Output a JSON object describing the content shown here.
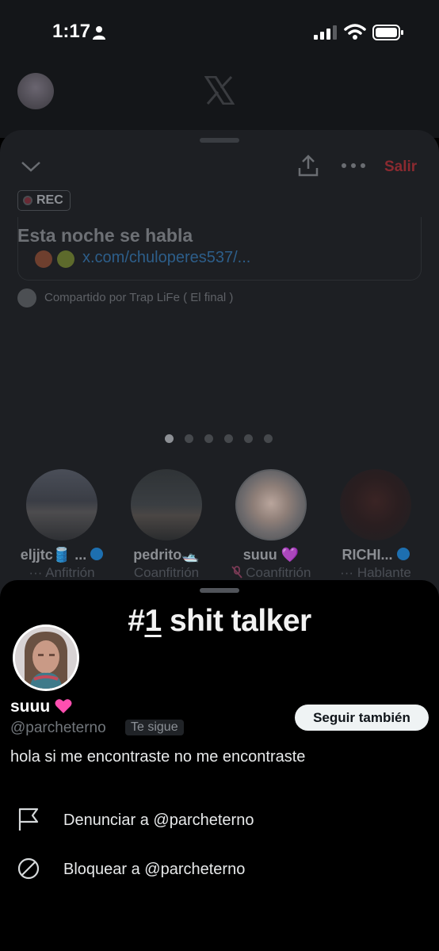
{
  "status_bar": {
    "time": "1:17"
  },
  "space": {
    "leave_label": "Salir",
    "rec_label": "REC",
    "title": "Esta noche se habla",
    "link": "x.com/chuloperes537/...",
    "shared_by": "Compartido por Trap LiFe ( El final )",
    "pager": {
      "count": 6,
      "active_index": 0
    },
    "speakers": [
      {
        "name": "elјjtc🛢️ ...",
        "role": "··· Anfitrión",
        "verified": true
      },
      {
        "name": "pedrito🛥️",
        "role": "Coanfitrión",
        "verified": false
      },
      {
        "name": "suuu 💜",
        "role": "Coanfitrión",
        "verified": false,
        "muted": true
      },
      {
        "name": "RICHI...",
        "role": "··· Hablante",
        "verified": true
      }
    ]
  },
  "profile": {
    "banner_prefix": "#",
    "banner_number": "1",
    "banner_suffix": " shit talker",
    "name": "suuu",
    "handle": "@parcheterno",
    "follows_you": "Te sigue",
    "follow_button": "Seguir también",
    "bio": "hola si me encontraste no me encontraste",
    "actions": [
      {
        "label": "Denunciar a @parcheterno",
        "icon": "flag-icon"
      },
      {
        "label": "Bloquear a @parcheterno",
        "icon": "block-icon"
      }
    ]
  },
  "colors": {
    "accent_red": "#8b2a30",
    "verified_blue": "#1d6fb0",
    "heart_pink": "#ff4fb0"
  }
}
